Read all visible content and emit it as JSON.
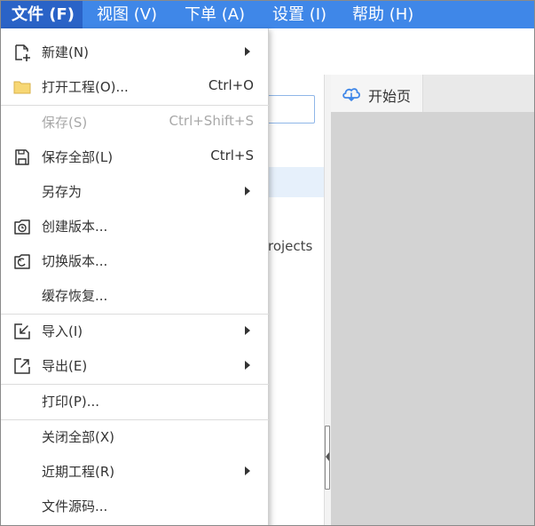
{
  "menubar": {
    "items": [
      {
        "label": "文件 (F)",
        "active": true
      },
      {
        "label": "视图 (V)",
        "active": false
      },
      {
        "label": "下单 (A)",
        "active": false
      },
      {
        "label": "设置 (I)",
        "active": false
      },
      {
        "label": "帮助 (H)",
        "active": false
      }
    ]
  },
  "file_menu": {
    "items": [
      {
        "label": "新建(N)",
        "shortcut": "",
        "icon": "new-file-icon",
        "submenu": true,
        "enabled": true
      },
      {
        "label": "打开工程(O)...",
        "shortcut": "Ctrl+O",
        "icon": "folder-icon",
        "submenu": false,
        "enabled": true
      },
      {
        "label": "保存(S)",
        "shortcut": "Ctrl+Shift+S",
        "icon": "",
        "submenu": false,
        "enabled": false
      },
      {
        "label": "保存全部(L)",
        "shortcut": "Ctrl+S",
        "icon": "save-all-icon",
        "submenu": false,
        "enabled": true
      },
      {
        "label": "另存为",
        "shortcut": "",
        "icon": "",
        "submenu": true,
        "enabled": true
      },
      {
        "label": "创建版本...",
        "shortcut": "",
        "icon": "create-version-icon",
        "submenu": false,
        "enabled": true
      },
      {
        "label": "切换版本...",
        "shortcut": "",
        "icon": "switch-version-icon",
        "submenu": false,
        "enabled": true
      },
      {
        "label": "缓存恢复...",
        "shortcut": "",
        "icon": "",
        "submenu": false,
        "enabled": true
      },
      {
        "label": "导入(I)",
        "shortcut": "",
        "icon": "import-icon",
        "submenu": true,
        "enabled": true
      },
      {
        "label": "导出(E)",
        "shortcut": "",
        "icon": "export-icon",
        "submenu": true,
        "enabled": true
      },
      {
        "label": "打印(P)...",
        "shortcut": "",
        "icon": "",
        "submenu": false,
        "enabled": true
      },
      {
        "label": "关闭全部(X)",
        "shortcut": "",
        "icon": "",
        "submenu": false,
        "enabled": true
      },
      {
        "label": "近期工程(R)",
        "shortcut": "",
        "icon": "",
        "submenu": true,
        "enabled": true
      },
      {
        "label": "文件源码...",
        "shortcut": "",
        "icon": "",
        "submenu": false,
        "enabled": true
      }
    ]
  },
  "background": {
    "partial_text": "rojects"
  },
  "tabs": [
    {
      "label": "开始页",
      "icon": "cloud-icon"
    }
  ],
  "colors": {
    "menubar_bg": "#3f87e8",
    "menubar_active": "#2a63c7",
    "workspace_bg": "#d3d3d3",
    "disabled_text": "#a8a8a8",
    "folder_yellow": "#f7d774",
    "cloud_blue": "#3f87e8"
  }
}
